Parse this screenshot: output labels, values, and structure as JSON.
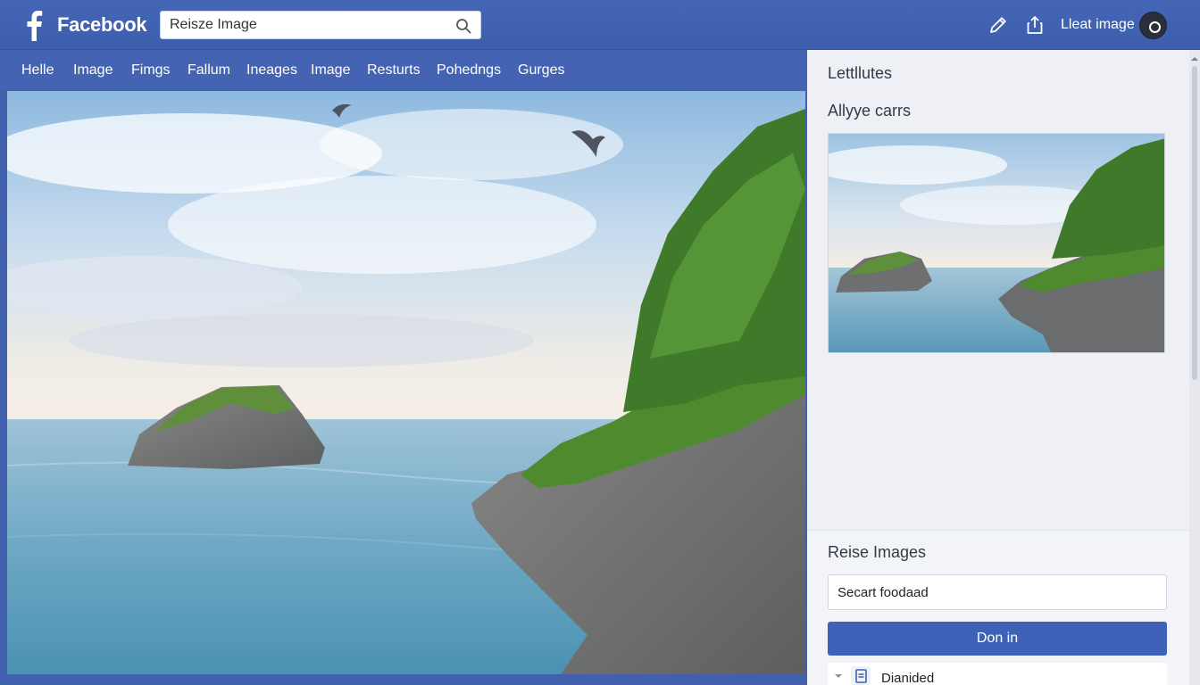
{
  "header": {
    "brand": "Facebook",
    "search_placeholder": "Reisze Image",
    "link": "Lleat image"
  },
  "nav": {
    "items": [
      "Helle",
      "Image",
      "Fimgs",
      "Fallum",
      "Ineages",
      "Image",
      "Resturts",
      "Pohedngs",
      "Gurges"
    ]
  },
  "side_panel": {
    "heading": "Lettllutes",
    "subheading": "Allyye carrs",
    "section_title": "Reise Images",
    "input_placeholder": "Secart foodaad",
    "primary_button": "Don in",
    "list_item": "Dianided"
  },
  "icons": {
    "logo": "facebook-f-logo",
    "search": "search-icon",
    "edit": "pencil-icon",
    "upload": "upload-icon",
    "list_chevron": "chevron-down-icon",
    "list_doc": "document-icon"
  },
  "colors": {
    "brand_blue": "#3d5ead",
    "button_blue": "#3d62b8",
    "panel_bg": "#eef0f5"
  }
}
